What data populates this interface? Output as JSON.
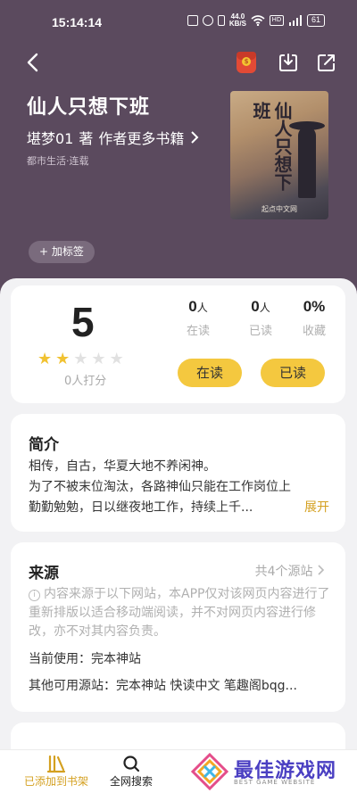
{
  "status_bar": {
    "time": "15:14:14",
    "speed": "44.0",
    "speed_unit": "KB/S",
    "battery": "61"
  },
  "book": {
    "title": "仙人只想下班",
    "author": "堪梦01",
    "author_role": "著",
    "author_more": "作者更多书籍",
    "genre": "都市生活·连载",
    "cover_title": "仙人只想下班",
    "cover_brand": "起点中文网"
  },
  "add_tag_label": "+ 加标签",
  "stats": {
    "score": "5",
    "stars_filled": 2,
    "stars_total": 5,
    "rating_count": "0人打分",
    "reading": {
      "value": "0",
      "unit": "人",
      "label": "在读"
    },
    "read": {
      "value": "0",
      "unit": "人",
      "label": "已读"
    },
    "collected": {
      "value": "0%",
      "label": "收藏"
    },
    "btn_reading": "在读",
    "btn_read": "已读"
  },
  "intro": {
    "title": "简介",
    "line1": "相传，自古，华夏大地不养闲神。",
    "line2": "为了不被末位淘汰，各路神仙只能在工作岗位上",
    "line3": "勤勤勉勉，日以继夜地工作，持续上千...",
    "expand": "展开"
  },
  "source": {
    "title": "来源",
    "count": "共4个源站",
    "note": "内容来源于以下网站，本APP仅对该网页内容进行了重新排版以适合移动端阅读，并不对网页内容进行修改，亦不对其内容负责。",
    "current": "当前使用：完本神站",
    "others": "其他可用源站：完本神站 快读中文 笔趣阁bqg..."
  },
  "bottom_nav": {
    "added": "已添加到书架",
    "search": "全网搜索"
  },
  "watermark": {
    "text": "最佳游戏网",
    "sub": "BEST GAME WEBSITE"
  },
  "colors": {
    "hero": "#5b4a5e",
    "accent": "#f4c83f",
    "star": "#f1c232",
    "expand": "#d4a020"
  },
  "icons": [
    "back-arrow-icon",
    "red-packet-icon",
    "download-icon",
    "share-icon",
    "star-icon",
    "info-icon",
    "bookshelf-icon",
    "search-icon"
  ]
}
